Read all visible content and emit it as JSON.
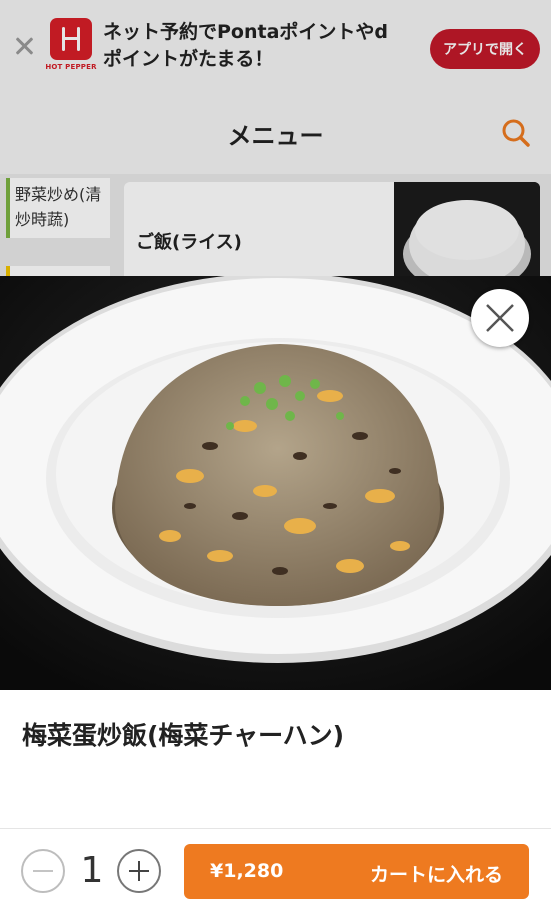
{
  "banner": {
    "close_icon": "close-icon",
    "logo_text": "HOT PEPPER",
    "message": "ネット予約でPontaポイントやdポイントがたまる！",
    "open_app_label": "アプリで開く",
    "brand_color": "#d71f28"
  },
  "header": {
    "title": "メニュー",
    "search_icon": "search-icon",
    "accent": "#ee7a20"
  },
  "menu": {
    "category": "野菜炒め(清炒時蔬)",
    "item_name": "ご飯(ライス)"
  },
  "modal": {
    "close_icon": "close-icon",
    "item_name": "梅菜蛋炒飯(梅菜チャーハン)"
  },
  "footer": {
    "quantity": "1",
    "minus_icon": "minus-icon",
    "plus_icon": "plus-icon",
    "price": "¥1,280",
    "cart_label": "カートに入れる",
    "button_color": "#ee7a20"
  }
}
